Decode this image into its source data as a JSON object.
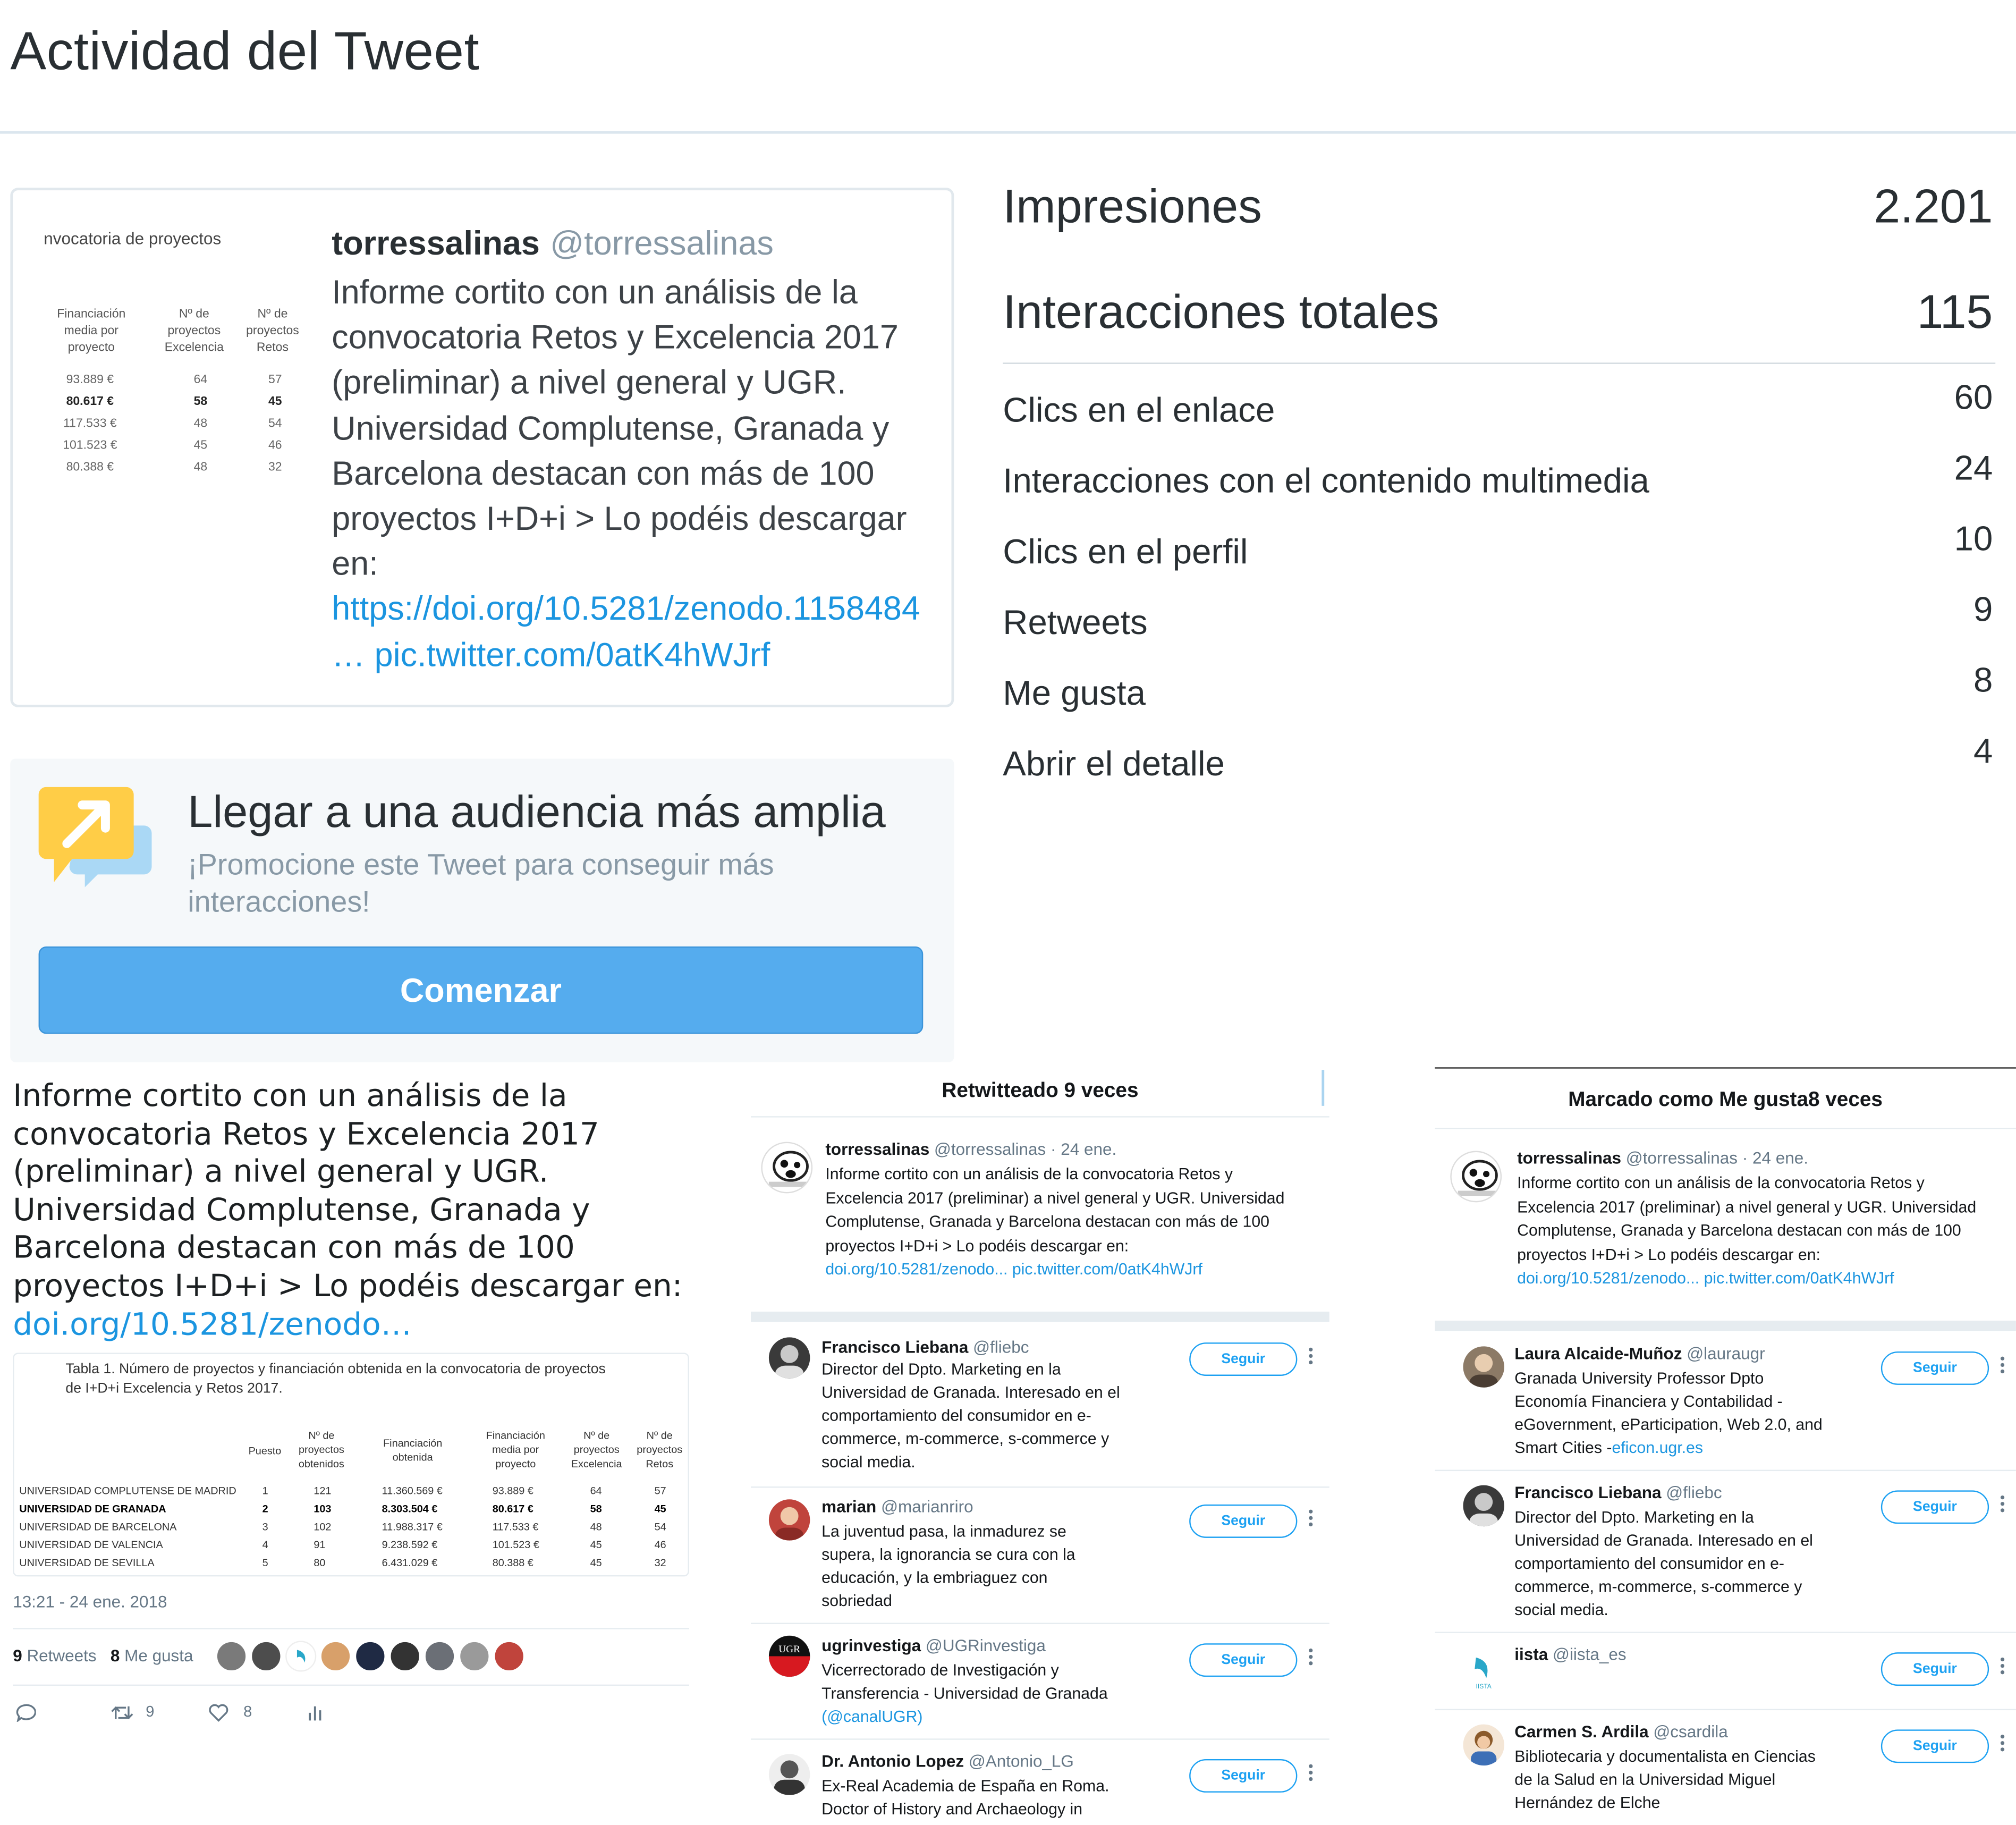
{
  "page_title": "Actividad del Tweet",
  "tweet": {
    "name": "torressalinas",
    "handle": "@torressalinas",
    "text": "Informe cortito con un análisis de la convocatoria Retos y Excelencia 2017 (preliminar) a nivel general y UGR. Universidad Complutense, Granada y Barcelona destacan con más de 100 proyectos I+D+i > Lo podéis descargar en:",
    "link_text": "https://doi.org/10.5281/zenodo.1158484 … pic.twitter.com/0atK4hWJrf",
    "thumbnail": {
      "title": "nvocatoria de proyectos",
      "headers": [
        "Financiación media por proyecto",
        "Nº de proyectos Excelencia",
        "Nº de proyectos Retos"
      ],
      "rows": [
        [
          "93.889 €",
          "64",
          "57"
        ],
        [
          "80.617 €",
          "58",
          "45"
        ],
        [
          "117.533 €",
          "48",
          "54"
        ],
        [
          "101.523 €",
          "45",
          "46"
        ],
        [
          "80.388 €",
          "48",
          "32"
        ]
      ]
    }
  },
  "promo": {
    "title": "Llegar a una audiencia más amplia",
    "subtitle": "¡Promocione este Tweet para conseguir más interacciones!",
    "button": "Comenzar"
  },
  "metrics": {
    "impressions": {
      "label": "Impresiones",
      "value": "2.201"
    },
    "engagements": {
      "label": "Interacciones totales",
      "value": "115"
    },
    "items": [
      {
        "label": "Clics en el enlace",
        "value": "60"
      },
      {
        "label": "Interacciones con el contenido multimedia",
        "value": "24"
      },
      {
        "label": "Clics en el perfil",
        "value": "10"
      },
      {
        "label": "Retweets",
        "value": "9"
      },
      {
        "label": "Me gusta",
        "value": "8"
      },
      {
        "label": "Abrir el detalle",
        "value": "4"
      }
    ]
  },
  "embed": {
    "text": "Informe cortito con un análisis de la convocatoria Retos y Excelencia 2017 (preliminar) a nivel general y UGR. Universidad Complutense, Granada y Barcelona destacan con más de 100 proyectos I+D+i > Lo podéis descargar en: ",
    "link": "doi.org/10.5281/zenodo…",
    "table": {
      "caption_1": "Tabla 1. Número de proyectos y  financiación obtenida en la convocatoria de proyectos",
      "caption_2": "de I+D+i Excelencia y Retos 2017.",
      "headers": [
        "Puesto",
        "Nº de proyectos obtenidos",
        "Financiación obtenida",
        "Financiación media por proyecto",
        "Nº de proyectos Excelencia",
        "Nº de proyectos Retos"
      ],
      "rows": [
        [
          "UNIVERSIDAD COMPLUTENSE DE MADRID",
          "1",
          "121",
          "11.360.569 €",
          "93.889 €",
          "64",
          "57"
        ],
        [
          "UNIVERSIDAD DE GRANADA",
          "2",
          "103",
          "8.303.504 €",
          "80.617 €",
          "58",
          "45"
        ],
        [
          "UNIVERSIDAD DE BARCELONA",
          "3",
          "102",
          "11.988.317 €",
          "117.533 €",
          "48",
          "54"
        ],
        [
          "UNIVERSIDAD DE VALENCIA",
          "4",
          "91",
          "9.238.592 €",
          "101.523 €",
          "45",
          "46"
        ],
        [
          "UNIVERSIDAD DE SEVILLA",
          "5",
          "80",
          "6.431.029 €",
          "80.388 €",
          "45",
          "32"
        ]
      ]
    },
    "time": "13:21 - 24 ene. 2018",
    "retweets_count": "9",
    "retweets_label": "Retweets",
    "likes_count": "8",
    "likes_label": "Me gusta",
    "action_retweets": "9",
    "action_likes": "8"
  },
  "retweets_modal": {
    "title": "Retwitteado 9 veces",
    "tweet": {
      "name": "torressalinas",
      "handle": "@torressalinas",
      "date": "· 24 ene.",
      "text": "Informe cortito con un análisis de la convocatoria Retos y Excelencia 2017 (preliminar) a nivel general y UGR. Universidad Complutense, Granada y Barcelona destacan con más de 100 proyectos I+D+i > Lo podéis descargar en:",
      "link": "doi.org/10.5281/zenodo... pic.twitter.com/0atK4hWJrf"
    },
    "follow_label": "Seguir",
    "users": [
      {
        "name": "Francisco Liebana",
        "handle": "@fliebc",
        "bio": "Director del Dpto. Marketing en la Universidad de Granada. Interesado en el comportamiento del consumidor en e-commerce, m-commerce, s-commerce y social media."
      },
      {
        "name": "marian",
        "handle": "@marianriro",
        "bio": "La juventud pasa, la inmadurez se supera, la ignorancia se cura con la educación, y la embriaguez con sobriedad"
      },
      {
        "name": "ugrinvestiga",
        "handle": "@UGRinvestiga",
        "bio": "Vicerrectorado de Investigación y Transferencia - Universidad de Granada",
        "bio_link": "(@canalUGR)"
      },
      {
        "name": "Dr. Antonio Lopez",
        "handle": "@Antonio_LG",
        "bio": "Ex-Real Academia de España en Roma. Doctor of History and Archaeology in"
      }
    ]
  },
  "likes_modal": {
    "title": "Marcado como Me gusta8 veces",
    "tweet": {
      "name": "torressalinas",
      "handle": "@torressalinas",
      "date": "· 24 ene.",
      "text": "Informe cortito con un análisis de la convocatoria Retos y Excelencia 2017 (preliminar) a nivel general y UGR. Universidad Complutense, Granada y Barcelona destacan con más de 100 proyectos I+D+i > Lo podéis descargar en:",
      "link": "doi.org/10.5281/zenodo... pic.twitter.com/0atK4hWJrf"
    },
    "follow_label": "Seguir",
    "users": [
      {
        "name": "Laura Alcaide-Muñoz",
        "handle": "@lauraugr",
        "bio": "Granada University Professor Dpto Economía Financiera y Contabilidad - eGovernment, eParticipation, Web 2.0, and Smart Cities -",
        "bio_link": "eficon.ugr.es"
      },
      {
        "name": "Francisco Liebana",
        "handle": "@fliebc",
        "bio": "Director del Dpto. Marketing en la Universidad de Granada. Interesado en el comportamiento del consumidor en e-commerce, m-commerce, s-commerce y social media."
      },
      {
        "name": "iista",
        "handle": "@iista_es",
        "bio": ""
      },
      {
        "name": "Carmen S. Ardila",
        "handle": "@csardila",
        "bio": "Bibliotecaria y documentalista en Ciencias de la Salud en la Universidad Miguel Hernández de Elche"
      }
    ]
  },
  "colors": {
    "accent": "#1da1f2",
    "button": "#55acee",
    "text": "#292f33",
    "muted": "#8899a6"
  },
  "icons": [
    "promote-icon",
    "reply-icon",
    "retweet-icon",
    "like-icon",
    "analytics-icon",
    "more-icon"
  ]
}
